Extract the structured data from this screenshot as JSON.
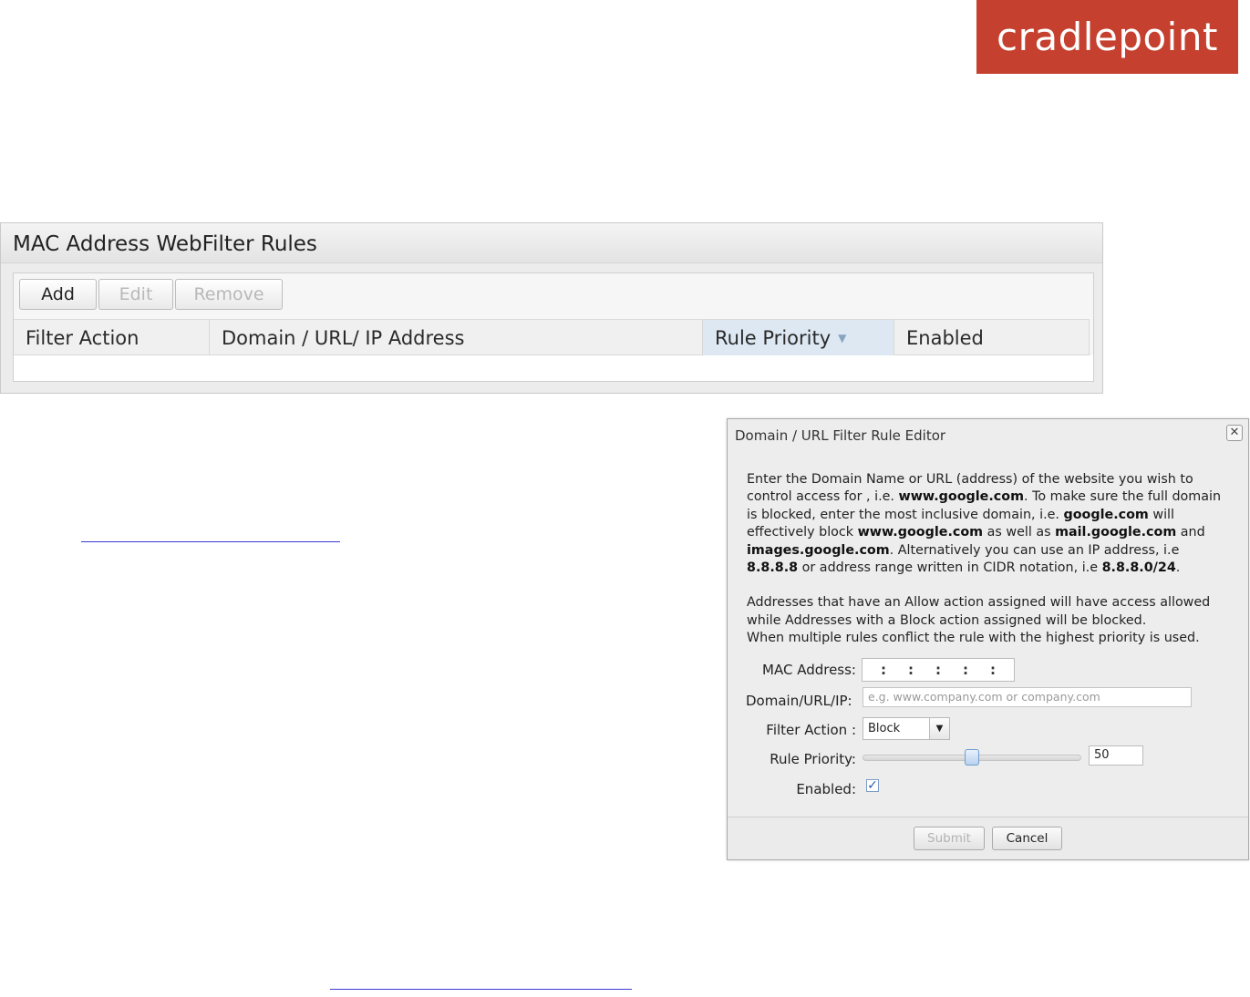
{
  "brand": {
    "name": "cradlepoint",
    "color": "#c5402e"
  },
  "rules_panel": {
    "title": "MAC Address WebFilter Rules",
    "toolbar": {
      "add_label": "Add",
      "edit_label": "Edit",
      "remove_label": "Remove"
    },
    "columns": [
      "Filter Action",
      "Domain / URL/ IP Address",
      "Rule Priority",
      "Enabled"
    ],
    "sort_indicator": "▼"
  },
  "dialog": {
    "title": "Domain / URL Filter Rule Editor",
    "close_icon": "✕",
    "desc_html": "<p>Enter the Domain Name or URL (address) of the website you wish to control access for , i.e. <b>www.google.com</b>. To make sure the full domain is blocked, enter the most inclusive domain, i.e. <b>google.com</b> will effectively block <b>www.google.com</b> as well as <b>mail.google.com</b> and <b>images.google.com</b>. Alternatively you can use an IP address, i.e <b>8.8.8.8</b> or address range written in CIDR notation, i.e <b>8.8.8.0/24</b>.</p><p style=\"margin:0\">Addresses that have an Allow action assigned will have access allowed while Addresses with a Block action assigned will be blocked.<br>When multiple rules conflict the rule with the highest priority is used.</p>",
    "fields": {
      "mac_label": "MAC Address:",
      "mac_separators": [
        ":",
        ":",
        ":",
        ":",
        ":"
      ],
      "domain_label": "Domain/URL/IP:",
      "domain_placeholder": "e.g. www.company.com or company.com",
      "action_label": "Filter Action :",
      "action_value": "Block",
      "priority_label": "Rule Priority:",
      "priority_value": "50",
      "priority_fraction": 0.5,
      "enabled_label": "Enabled:",
      "enabled_checked": true
    },
    "submit_label": "Submit",
    "cancel_label": "Cancel"
  }
}
